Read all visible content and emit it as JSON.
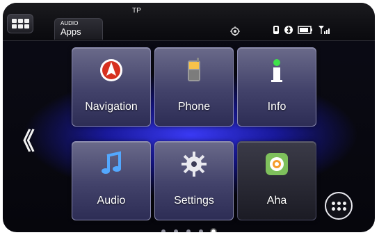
{
  "topbar": {
    "tab_small": "AUDIO",
    "tab_big": "Apps",
    "tp": "TP"
  },
  "tiles": [
    {
      "label": "Navigation",
      "icon": "navigation-icon"
    },
    {
      "label": "Phone",
      "icon": "phone-icon"
    },
    {
      "label": "Info",
      "icon": "info-icon"
    },
    {
      "label": "Audio",
      "icon": "music-note-icon"
    },
    {
      "label": "Settings",
      "icon": "gear-icon"
    },
    {
      "label": "Aha",
      "icon": "aha-icon"
    }
  ],
  "left_arrow": "《",
  "pager": {
    "count": 5,
    "active_index": 4
  }
}
